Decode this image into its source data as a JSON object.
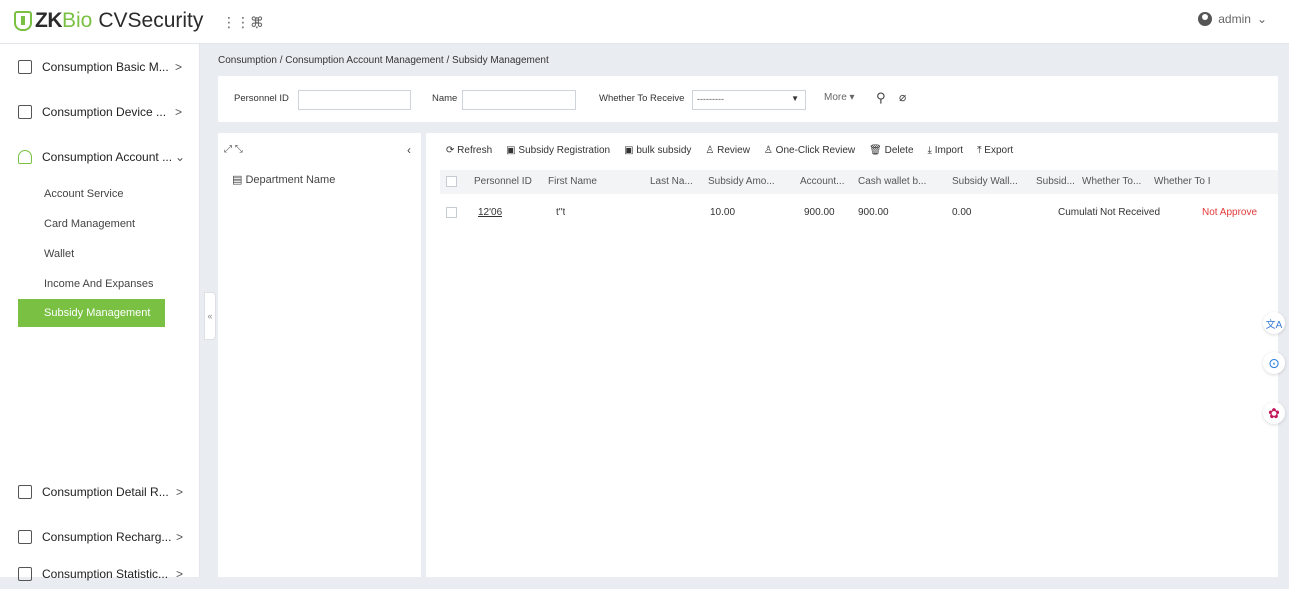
{
  "brand": {
    "zk": "ZK",
    "bio": "Bio",
    "name": "CVSecurity"
  },
  "topbar": {
    "apps_glyph": "⋮⋮⋮",
    "cmd_glyph": "⌘",
    "user": "admin",
    "user_caret": "⌄"
  },
  "sidebar": {
    "items": [
      {
        "label": "Consumption Basic M...",
        "arrow": ">"
      },
      {
        "label": "Consumption Device ...",
        "arrow": ">"
      },
      {
        "label": "Consumption Account ...",
        "arrow": "⌄"
      }
    ],
    "sub_items": [
      "Account Service",
      "Card Management",
      "Wallet",
      "Income And Expanses",
      "Subsidy Management"
    ],
    "bottom_items": [
      {
        "label": "Consumption Detail R...",
        "arrow": ">"
      },
      {
        "label": "Consumption Recharg...",
        "arrow": ">"
      },
      {
        "label": "Consumption Statistic...",
        "arrow": ">"
      }
    ],
    "collapse_glyph": "«"
  },
  "breadcrumb": "Consumption / Consumption Account Management / Subsidy Management",
  "filter": {
    "personnel_id_label": "Personnel ID",
    "name_label": "Name",
    "receive_label": "Whether To Receive",
    "receive_value": "---------",
    "more_label": "More ▾"
  },
  "dept": {
    "expand_glyph": "⤢ ⤡",
    "collapse_glyph": "‹",
    "name": "Department Name"
  },
  "toolbar": {
    "refresh": "⟳ Refresh",
    "subsidy_registration": "▣ Subsidy Registration",
    "bulk_subsidy": "▣ bulk subsidy",
    "review": "♙ Review",
    "one_click_review": "♙ One-Click Review",
    "delete": "🗑 Delete",
    "import": "⤓ Import",
    "export": "⤒ Export"
  },
  "table": {
    "headers": [
      "Personnel ID",
      "First Name",
      "Last Na...",
      "Subsidy Amo...",
      "Account...",
      "Cash wallet b...",
      "Subsidy Wall...",
      "Subsid...",
      "Whether To...",
      "Whether To I"
    ],
    "rows": [
      [
        "12'06",
        "t''t",
        "",
        "10.00",
        "900.00",
        "900.00",
        "0.00",
        "Cumulativ",
        "Not Received",
        "Not Approve"
      ]
    ]
  },
  "floats": {
    "translate": "文A",
    "bot": "⊙",
    "brain": "✿"
  },
  "colors": {
    "accent": "#7ac143",
    "danger": "#e23a3a"
  }
}
